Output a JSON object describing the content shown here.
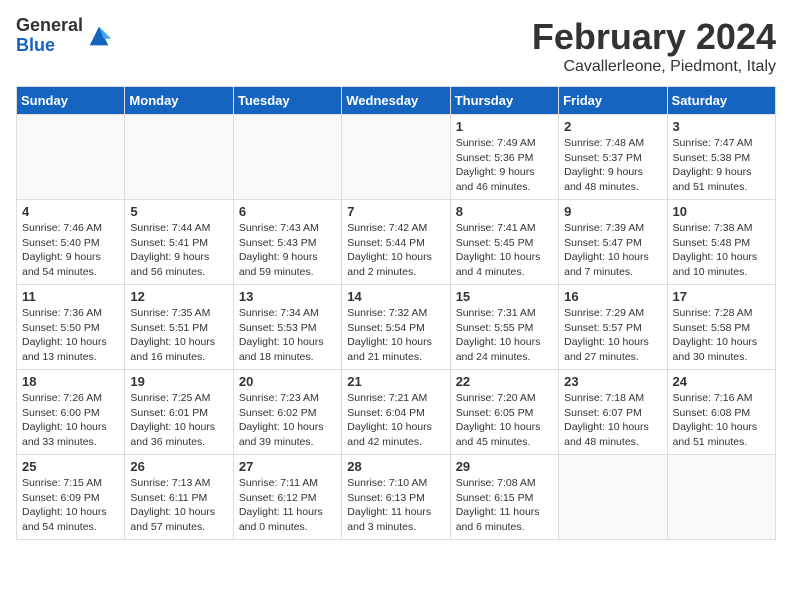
{
  "header": {
    "logo_general": "General",
    "logo_blue": "Blue",
    "month_title": "February 2024",
    "location": "Cavallerleone, Piedmont, Italy"
  },
  "calendar": {
    "days_of_week": [
      "Sunday",
      "Monday",
      "Tuesday",
      "Wednesday",
      "Thursday",
      "Friday",
      "Saturday"
    ],
    "weeks": [
      [
        {
          "day": "",
          "info": ""
        },
        {
          "day": "",
          "info": ""
        },
        {
          "day": "",
          "info": ""
        },
        {
          "day": "",
          "info": ""
        },
        {
          "day": "1",
          "info": "Sunrise: 7:49 AM\nSunset: 5:36 PM\nDaylight: 9 hours\nand 46 minutes."
        },
        {
          "day": "2",
          "info": "Sunrise: 7:48 AM\nSunset: 5:37 PM\nDaylight: 9 hours\nand 48 minutes."
        },
        {
          "day": "3",
          "info": "Sunrise: 7:47 AM\nSunset: 5:38 PM\nDaylight: 9 hours\nand 51 minutes."
        }
      ],
      [
        {
          "day": "4",
          "info": "Sunrise: 7:46 AM\nSunset: 5:40 PM\nDaylight: 9 hours\nand 54 minutes."
        },
        {
          "day": "5",
          "info": "Sunrise: 7:44 AM\nSunset: 5:41 PM\nDaylight: 9 hours\nand 56 minutes."
        },
        {
          "day": "6",
          "info": "Sunrise: 7:43 AM\nSunset: 5:43 PM\nDaylight: 9 hours\nand 59 minutes."
        },
        {
          "day": "7",
          "info": "Sunrise: 7:42 AM\nSunset: 5:44 PM\nDaylight: 10 hours\nand 2 minutes."
        },
        {
          "day": "8",
          "info": "Sunrise: 7:41 AM\nSunset: 5:45 PM\nDaylight: 10 hours\nand 4 minutes."
        },
        {
          "day": "9",
          "info": "Sunrise: 7:39 AM\nSunset: 5:47 PM\nDaylight: 10 hours\nand 7 minutes."
        },
        {
          "day": "10",
          "info": "Sunrise: 7:38 AM\nSunset: 5:48 PM\nDaylight: 10 hours\nand 10 minutes."
        }
      ],
      [
        {
          "day": "11",
          "info": "Sunrise: 7:36 AM\nSunset: 5:50 PM\nDaylight: 10 hours\nand 13 minutes."
        },
        {
          "day": "12",
          "info": "Sunrise: 7:35 AM\nSunset: 5:51 PM\nDaylight: 10 hours\nand 16 minutes."
        },
        {
          "day": "13",
          "info": "Sunrise: 7:34 AM\nSunset: 5:53 PM\nDaylight: 10 hours\nand 18 minutes."
        },
        {
          "day": "14",
          "info": "Sunrise: 7:32 AM\nSunset: 5:54 PM\nDaylight: 10 hours\nand 21 minutes."
        },
        {
          "day": "15",
          "info": "Sunrise: 7:31 AM\nSunset: 5:55 PM\nDaylight: 10 hours\nand 24 minutes."
        },
        {
          "day": "16",
          "info": "Sunrise: 7:29 AM\nSunset: 5:57 PM\nDaylight: 10 hours\nand 27 minutes."
        },
        {
          "day": "17",
          "info": "Sunrise: 7:28 AM\nSunset: 5:58 PM\nDaylight: 10 hours\nand 30 minutes."
        }
      ],
      [
        {
          "day": "18",
          "info": "Sunrise: 7:26 AM\nSunset: 6:00 PM\nDaylight: 10 hours\nand 33 minutes."
        },
        {
          "day": "19",
          "info": "Sunrise: 7:25 AM\nSunset: 6:01 PM\nDaylight: 10 hours\nand 36 minutes."
        },
        {
          "day": "20",
          "info": "Sunrise: 7:23 AM\nSunset: 6:02 PM\nDaylight: 10 hours\nand 39 minutes."
        },
        {
          "day": "21",
          "info": "Sunrise: 7:21 AM\nSunset: 6:04 PM\nDaylight: 10 hours\nand 42 minutes."
        },
        {
          "day": "22",
          "info": "Sunrise: 7:20 AM\nSunset: 6:05 PM\nDaylight: 10 hours\nand 45 minutes."
        },
        {
          "day": "23",
          "info": "Sunrise: 7:18 AM\nSunset: 6:07 PM\nDaylight: 10 hours\nand 48 minutes."
        },
        {
          "day": "24",
          "info": "Sunrise: 7:16 AM\nSunset: 6:08 PM\nDaylight: 10 hours\nand 51 minutes."
        }
      ],
      [
        {
          "day": "25",
          "info": "Sunrise: 7:15 AM\nSunset: 6:09 PM\nDaylight: 10 hours\nand 54 minutes."
        },
        {
          "day": "26",
          "info": "Sunrise: 7:13 AM\nSunset: 6:11 PM\nDaylight: 10 hours\nand 57 minutes."
        },
        {
          "day": "27",
          "info": "Sunrise: 7:11 AM\nSunset: 6:12 PM\nDaylight: 11 hours\nand 0 minutes."
        },
        {
          "day": "28",
          "info": "Sunrise: 7:10 AM\nSunset: 6:13 PM\nDaylight: 11 hours\nand 3 minutes."
        },
        {
          "day": "29",
          "info": "Sunrise: 7:08 AM\nSunset: 6:15 PM\nDaylight: 11 hours\nand 6 minutes."
        },
        {
          "day": "",
          "info": ""
        },
        {
          "day": "",
          "info": ""
        }
      ]
    ]
  }
}
